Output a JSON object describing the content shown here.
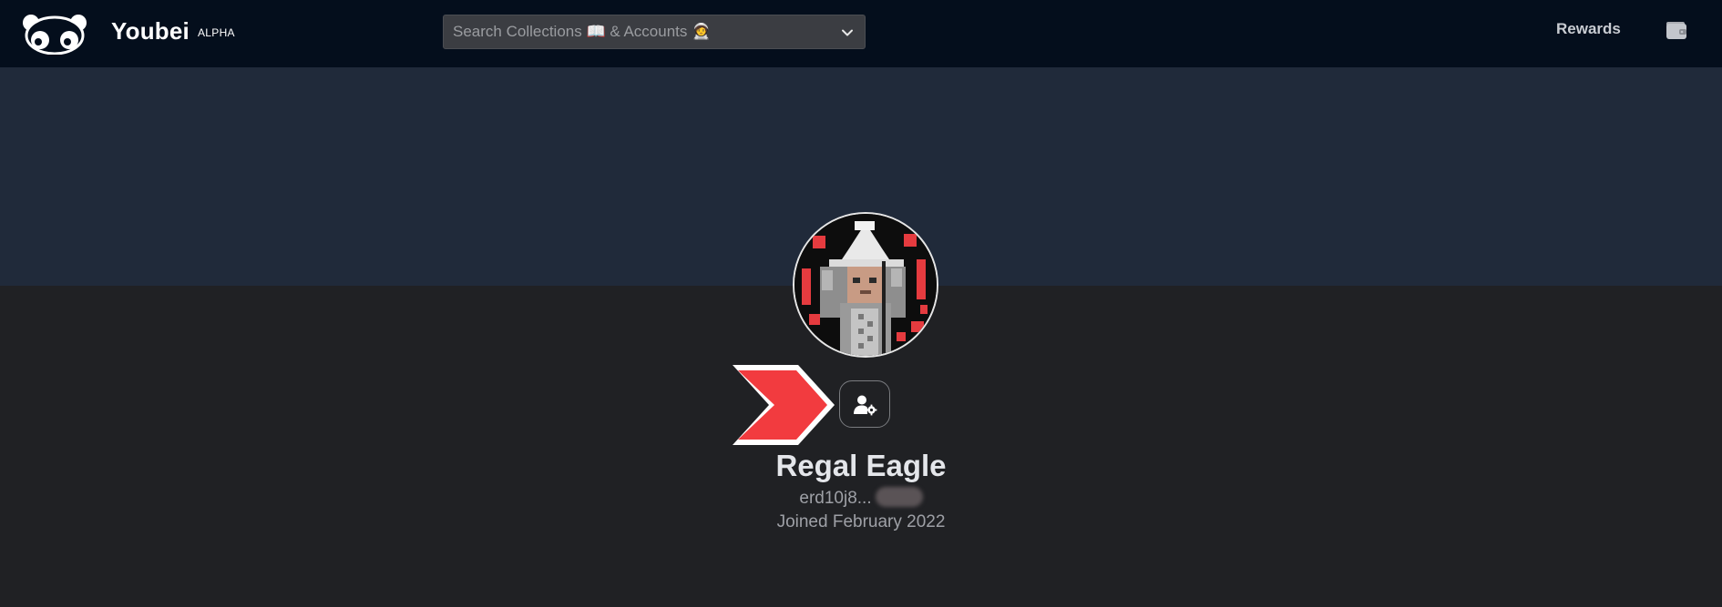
{
  "header": {
    "brand": "Youbei",
    "badge": "ALPHA",
    "search_placeholder": "Search Collections 📖 & Accounts 🧑‍🚀",
    "rewards_label": "Rewards"
  },
  "icons": {
    "logo": "panda-logo-icon",
    "search_dropdown": "chevron-down-icon",
    "wallet": "wallet-icon",
    "profile_settings": "user-gear-icon",
    "annotation": "red-arrow-icon"
  },
  "profile": {
    "name": "Regal Eagle",
    "address": "erd10j8...",
    "joined": "Joined February 2022"
  },
  "colors": {
    "topbar": "#040e1c",
    "banner": "#202a3a",
    "page": "#202124",
    "annotation_arrow": "#f23b3f"
  }
}
